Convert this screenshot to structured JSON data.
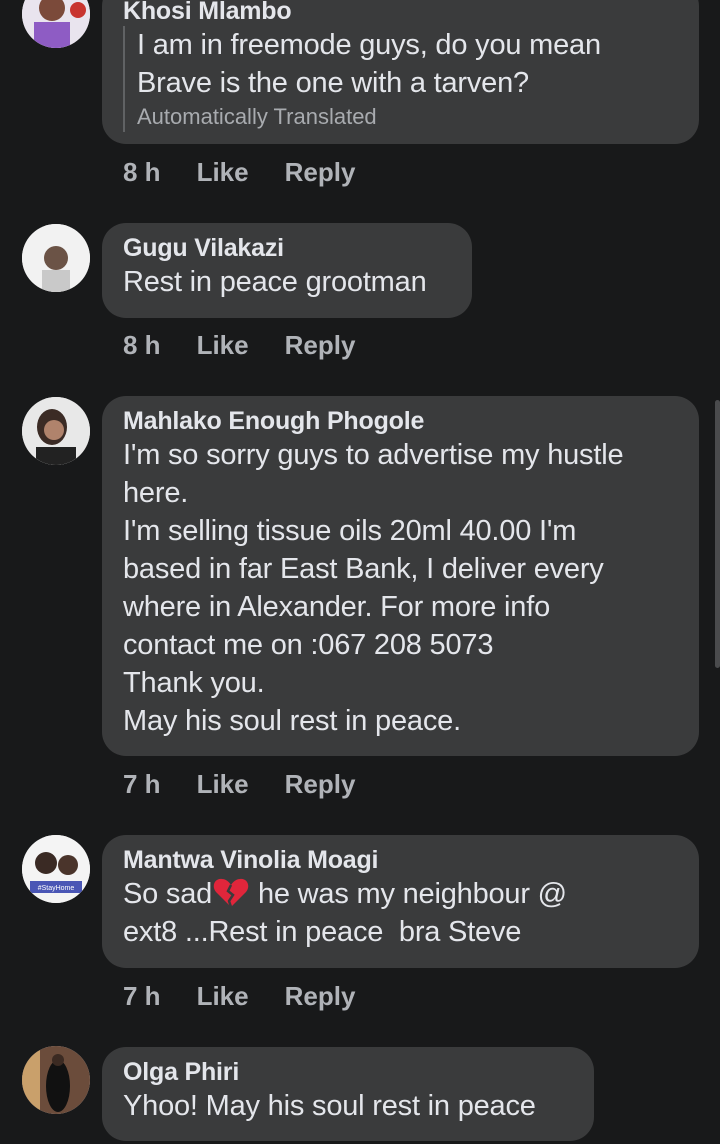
{
  "comments": [
    {
      "author": "Khosi Mlambo",
      "lines": [
        "I am in freemode guys, do you mean",
        "Brave is the one with a tarven?"
      ],
      "translated_label": "Automatically Translated",
      "time": "8 h",
      "like": "Like",
      "reply": "Reply"
    },
    {
      "author": "Gugu Vilakazi",
      "text": "Rest in peace grootman",
      "time": "8 h",
      "like": "Like",
      "reply": "Reply"
    },
    {
      "author": "Mahlako Enough Phogole",
      "text": "I'm so sorry guys to advertise my hustle\nhere.\nI'm selling tissue oils 20ml 40.00 I'm\nbased in far East Bank, I deliver every\nwhere in Alexander. For more info\ncontact me on :067 208 5073\nThank you.\nMay his soul rest in peace.",
      "time": "7 h",
      "like": "Like",
      "reply": "Reply"
    },
    {
      "author": "Mantwa Vinolia Moagi",
      "text_before_emoji": "So sad",
      "emoji": "broken-heart",
      "text_after_emoji": " he was my neighbour @",
      "text_line2": "ext8 ...Rest in peace  bra Steve",
      "avatar_caption": "#StayHome",
      "time": "7 h",
      "like": "Like",
      "reply": "Reply"
    },
    {
      "author": "Olga Phiri",
      "text": "Yhoo! May his soul rest in peace"
    }
  ],
  "colors": {
    "background": "#18191a",
    "bubble": "#3a3b3c",
    "text": "#e4e6eb",
    "meta": "#b0b3b8"
  }
}
